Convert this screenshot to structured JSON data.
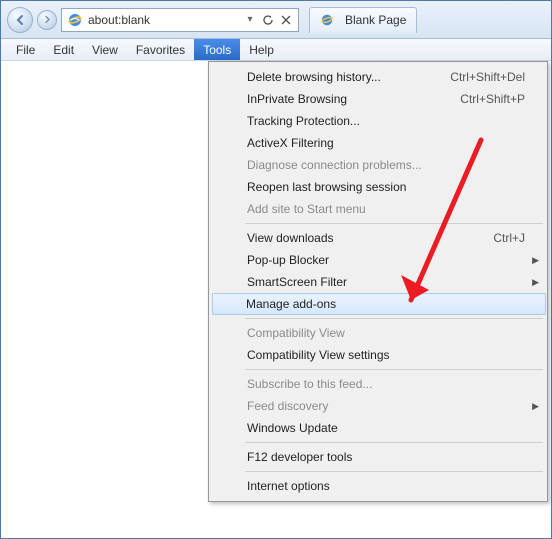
{
  "address": {
    "url": "about:blank",
    "tab_title": "Blank Page"
  },
  "menubar": {
    "file": "File",
    "edit": "Edit",
    "view": "View",
    "favorites": "Favorites",
    "tools": "Tools",
    "help": "Help"
  },
  "tools_menu": {
    "delete_history": "Delete browsing history...",
    "delete_history_shortcut": "Ctrl+Shift+Del",
    "inprivate": "InPrivate Browsing",
    "inprivate_shortcut": "Ctrl+Shift+P",
    "tracking": "Tracking Protection...",
    "activex": "ActiveX Filtering",
    "diagnose": "Diagnose connection problems...",
    "reopen": "Reopen last browsing session",
    "add_start": "Add site to Start menu",
    "view_downloads": "View downloads",
    "view_downloads_shortcut": "Ctrl+J",
    "popup": "Pop-up Blocker",
    "smartscreen": "SmartScreen Filter",
    "manage_addons": "Manage add-ons",
    "compat_view": "Compatibility View",
    "compat_settings": "Compatibility View settings",
    "subscribe": "Subscribe to this feed...",
    "feed_discovery": "Feed discovery",
    "windows_update": "Windows Update",
    "f12": "F12 developer tools",
    "internet_options": "Internet options"
  }
}
